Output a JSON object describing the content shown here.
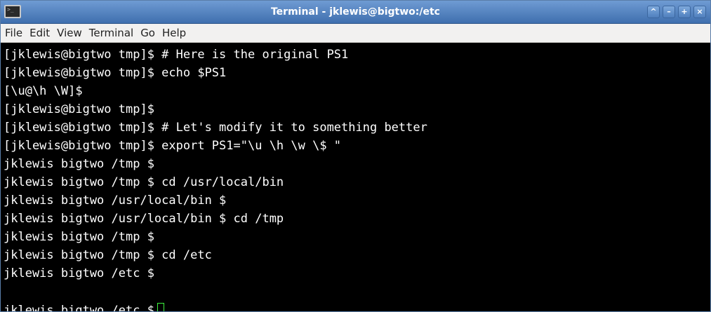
{
  "window": {
    "title": "Terminal - jklewis@bigtwo:/etc",
    "icon": "terminal-icon",
    "controls": [
      {
        "name": "minimize",
        "glyph": "^"
      },
      {
        "name": "shade",
        "glyph": "–"
      },
      {
        "name": "maximize",
        "glyph": "+"
      },
      {
        "name": "close",
        "glyph": "×"
      }
    ]
  },
  "menu": {
    "items": [
      "File",
      "Edit",
      "View",
      "Terminal",
      "Go",
      "Help"
    ]
  },
  "terminal": {
    "lines": [
      "[jklewis@bigtwo tmp]$ # Here is the original PS1",
      "[jklewis@bigtwo tmp]$ echo $PS1",
      "[\\u@\\h \\W]$",
      "[jklewis@bigtwo tmp]$",
      "[jklewis@bigtwo tmp]$ # Let's modify it to something better",
      "[jklewis@bigtwo tmp]$ export PS1=\"\\u \\h \\w \\$ \"",
      "jklewis bigtwo /tmp $",
      "jklewis bigtwo /tmp $ cd /usr/local/bin",
      "jklewis bigtwo /usr/local/bin $",
      "jklewis bigtwo /usr/local/bin $ cd /tmp",
      "jklewis bigtwo /tmp $",
      "jklewis bigtwo /tmp $ cd /etc",
      "jklewis bigtwo /etc $",
      "",
      "jklewis bigtwo /etc $"
    ],
    "cursor_color": "#3df23d"
  },
  "colors": {
    "titlebar": "#4f7fbd",
    "terminal_bg": "#000000",
    "terminal_fg": "#ffffff"
  }
}
